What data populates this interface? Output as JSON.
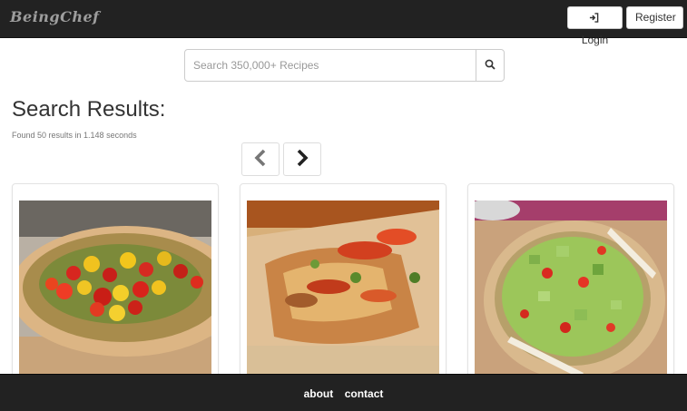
{
  "navbar": {
    "brand": "BeingChef",
    "login_label": "Login",
    "register_label": "Register"
  },
  "search": {
    "placeholder": "Search 350,000+ Recipes",
    "value": ""
  },
  "results": {
    "title": "Search Results:",
    "meta": "Found 50 results in 1.148 seconds"
  },
  "pager": {
    "prev_icon": "chevron-left-icon",
    "next_icon": "chevron-right-icon"
  },
  "cards": [
    {
      "image": "pizza-cherry-tomato-photo"
    },
    {
      "image": "pizza-slice-closeup-photo"
    },
    {
      "image": "pizza-avocado-salad-photo"
    }
  ],
  "footer": {
    "about": "about",
    "contact": "contact"
  },
  "colors": {
    "navbar_bg": "#222222",
    "footer_bg": "#222222",
    "brand": "#9d9d9d"
  }
}
